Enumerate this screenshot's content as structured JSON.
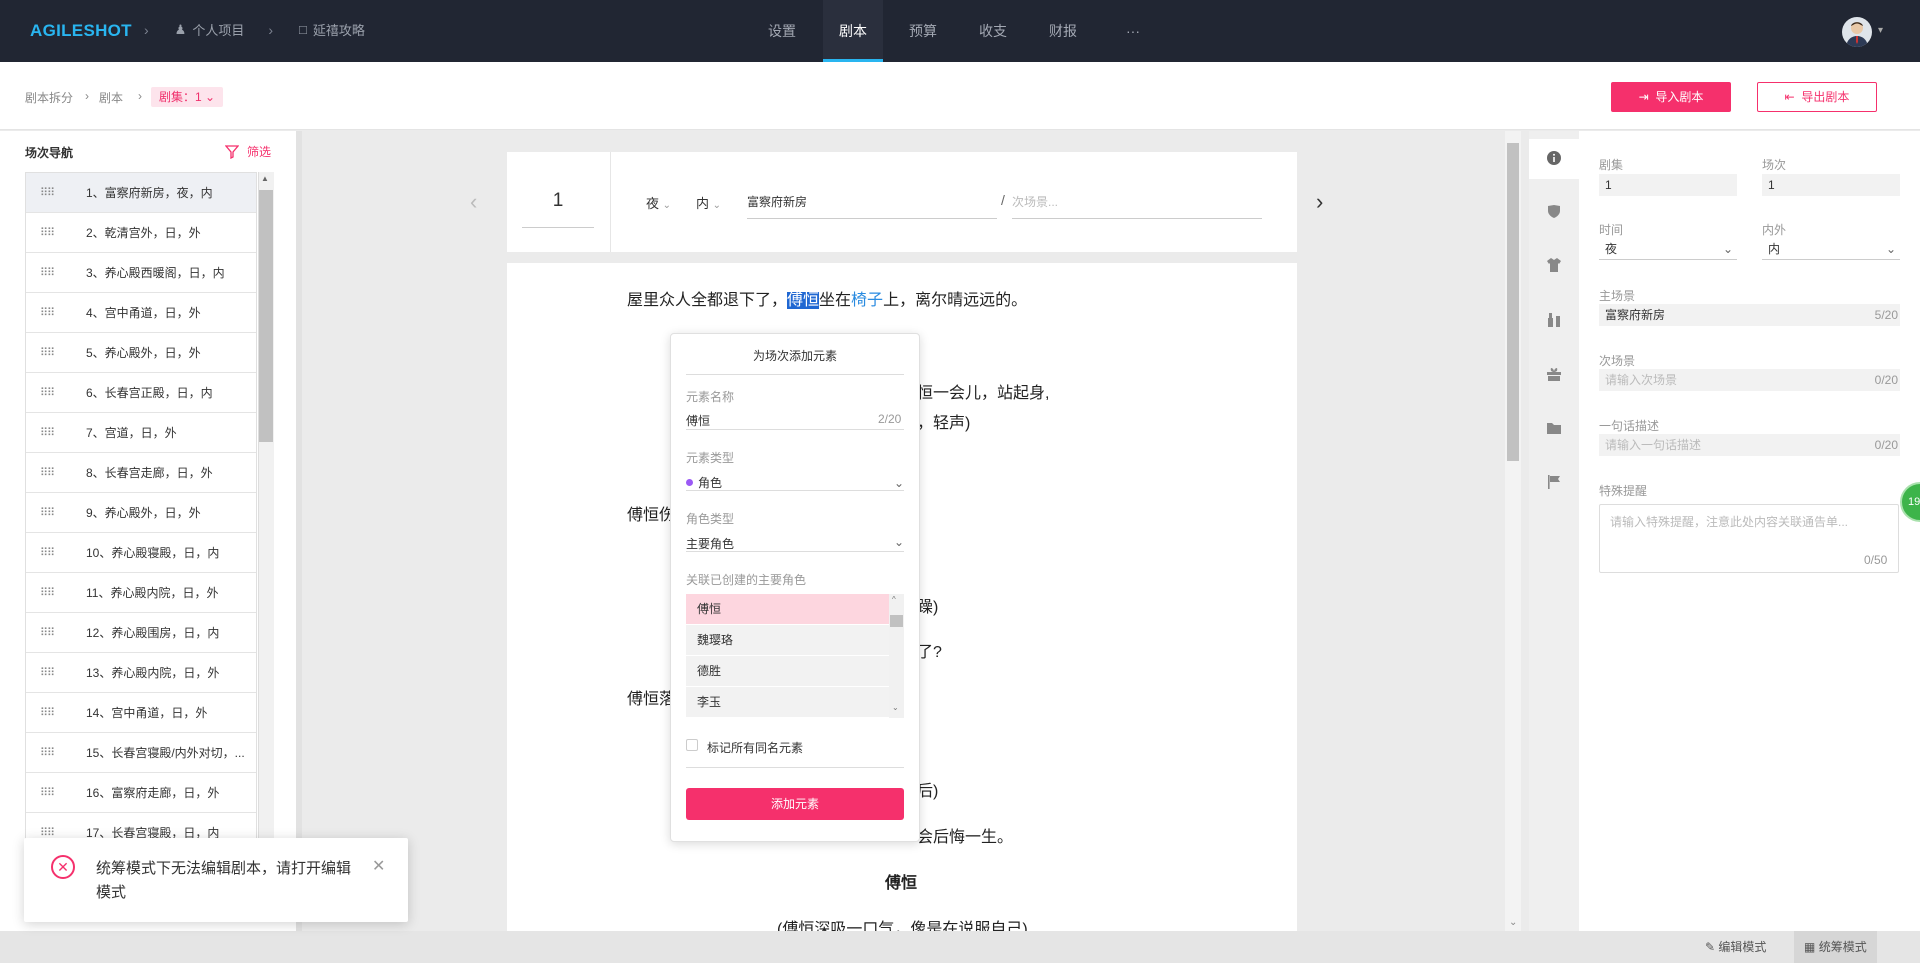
{
  "topbar": {
    "logo": "AGILESHOT",
    "crumbs": [
      "个人项目",
      "延禧攻略"
    ],
    "tabs": [
      "设置",
      "剧本",
      "预算",
      "收支",
      "财报",
      "···"
    ],
    "active_tab": "剧本"
  },
  "subbar": {
    "breadcrumb": [
      "剧本拆分",
      "剧本"
    ],
    "episode_tag": "剧集：1",
    "import_label": "导入剧本",
    "export_label": "导出剧本"
  },
  "sidebar": {
    "title": "场次导航",
    "filter_label": "筛选",
    "scenes": [
      "1、富察府新房，夜，内",
      "2、乾清宫外，日，外",
      "3、养心殿西暖阁，日，内",
      "4、宫中甬道，日，外",
      "5、养心殿外，日，外",
      "6、长春宫正殿，日，内",
      "7、宫道，日，外",
      "8、长春宫走廊，日，外",
      "9、养心殿外，日，外",
      "10、养心殿寝殿，日，内",
      "11、养心殿内院，日，外",
      "12、养心殿围房，日，内",
      "13、养心殿内院，日，外",
      "14、宫中甬道，日，外",
      "15、长春宫寝殿/内外对切，...",
      "16、富察府走廊，日，外",
      "17、长春宫寝殿，日，内"
    ]
  },
  "editor": {
    "scene_number": "1",
    "time": "夜",
    "inout": "内",
    "main_location": "富察府新房",
    "sub_location_placeholder": "次场景...",
    "lines": {
      "l1_a": "屋里众人全都退下了，",
      "l1_hl": "傅恒",
      "l1_b": "坐在",
      "l1_c": "椅子",
      "l1_d": "上，离尔晴远远的。",
      "l2": "恒一会儿，站起身,",
      "l3": "，轻声)",
      "l4": "傅恒伤",
      "l5": "躁)",
      "l6": "了?",
      "l7": "傅恒落",
      "l8": "后)",
      "l9": "会后悔一生。",
      "l10": "傅恒",
      "l11": "(傅恒深吸一口气，像是在说服自己)"
    }
  },
  "popup": {
    "title": "为场次添加元素",
    "name_label": "元素名称",
    "name_value": "傅恒",
    "name_count": "2/20",
    "type_label": "元素类型",
    "type_value": "角色",
    "role_label": "角色类型",
    "role_value": "主要角色",
    "link_label": "关联已创建的主要角色",
    "options": [
      "傅恒",
      "魏璎珞",
      "德胜",
      "李玉"
    ],
    "checkbox_label": "标记所有同名元素",
    "button_label": "添加元素"
  },
  "info": {
    "episode_label": "剧集",
    "episode_value": "1",
    "scene_label": "场次",
    "scene_value": "1",
    "time_label": "时间",
    "time_value": "夜",
    "inout_label": "内外",
    "inout_value": "内",
    "main_label": "主场景",
    "main_value": "富察府新房",
    "main_count": "5/20",
    "sub_label": "次场景",
    "sub_placeholder": "请输入次场景",
    "sub_count": "0/20",
    "desc_label": "一句话描述",
    "desc_placeholder": "请输入一句话描述",
    "desc_count": "0/20",
    "remark_label": "特殊提醒",
    "remark_placeholder": "请输入特殊提醒，注意此处内容关联通告单...",
    "remark_count": "0/50",
    "badge": "19"
  },
  "toast": {
    "message": "统筹模式下无法编辑剧本，请打开编辑模式"
  },
  "bottombar": {
    "edit_mode": "编辑模式",
    "plan_mode": "统筹模式"
  },
  "colors": {
    "accent": "#f5306c",
    "brand_blue": "#29b5f0",
    "nav_bg": "#212633"
  }
}
